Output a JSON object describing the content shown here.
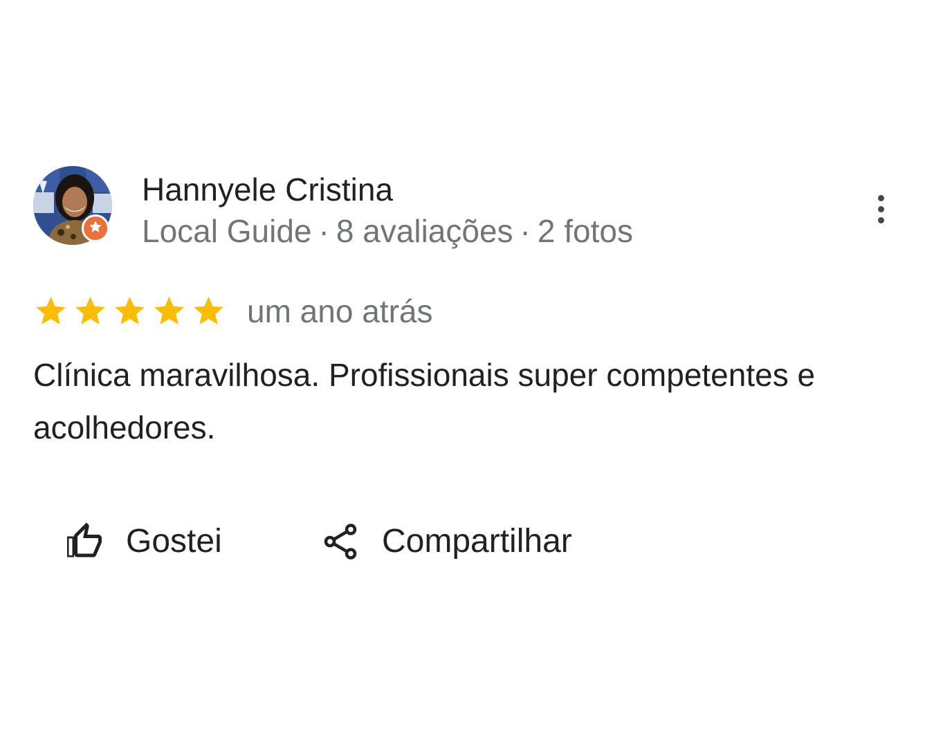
{
  "reviewer": {
    "name": "Hannyele Cristina",
    "badge": "Local Guide",
    "reviews": "8 avaliações",
    "photos": "2 fotos",
    "separator": "·"
  },
  "review": {
    "rating": 5,
    "max_rating": 5,
    "date": "um ano atrás",
    "text": "Clínica maravilhosa. Profissionais super competentes e acolhedores."
  },
  "actions": {
    "like_label": "Gostei",
    "share_label": "Compartilhar"
  },
  "icons": {
    "like": "thumb-up-icon",
    "share": "share-icon",
    "more": "more-vert-icon",
    "star": "star-icon",
    "badge": "local-guide-star-icon"
  },
  "colors": {
    "star": "#fbbc04",
    "name_text": "#202124",
    "meta_text": "#70757a",
    "badge": "#e8713c"
  }
}
